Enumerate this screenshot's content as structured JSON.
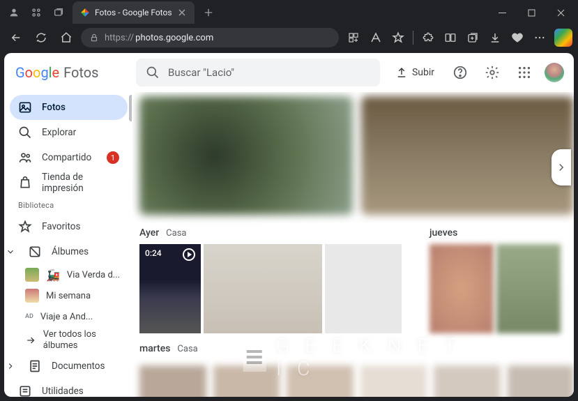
{
  "browser": {
    "tab_title": "Fotos - Google Fotos",
    "url_prefix": "https://",
    "url_host": "photos.google.com",
    "new_tab": "+"
  },
  "header": {
    "logo_suffix": "Fotos",
    "search_placeholder": "Buscar \"Lacio\"",
    "upload_label": "Subir"
  },
  "sidebar": {
    "items": [
      {
        "label": "Fotos"
      },
      {
        "label": "Explorar"
      },
      {
        "label": "Compartido",
        "badge": "1"
      },
      {
        "label": "Tienda de impresión"
      }
    ],
    "library_label": "Biblioteca",
    "lib_items": [
      {
        "label": "Favoritos"
      },
      {
        "label": "Álbumes"
      },
      {
        "label": "Documentos"
      },
      {
        "label": "Utilidades"
      }
    ],
    "albums": [
      {
        "label": "Via Verda d...",
        "type": "thumb"
      },
      {
        "label": "Mi semana",
        "type": "thumb"
      },
      {
        "label": "Viaje a And...",
        "type": "ad",
        "prefix": "AD"
      },
      {
        "label": "Ver todos los álbumes",
        "type": "arrow"
      }
    ]
  },
  "content": {
    "groups": [
      {
        "date": "Ayer",
        "place": "Casa",
        "video_duration": "0:24"
      },
      {
        "date": "jueves",
        "place": ""
      },
      {
        "date": "martes",
        "place": "Casa"
      }
    ]
  },
  "watermark": "G E E K N E T I C"
}
